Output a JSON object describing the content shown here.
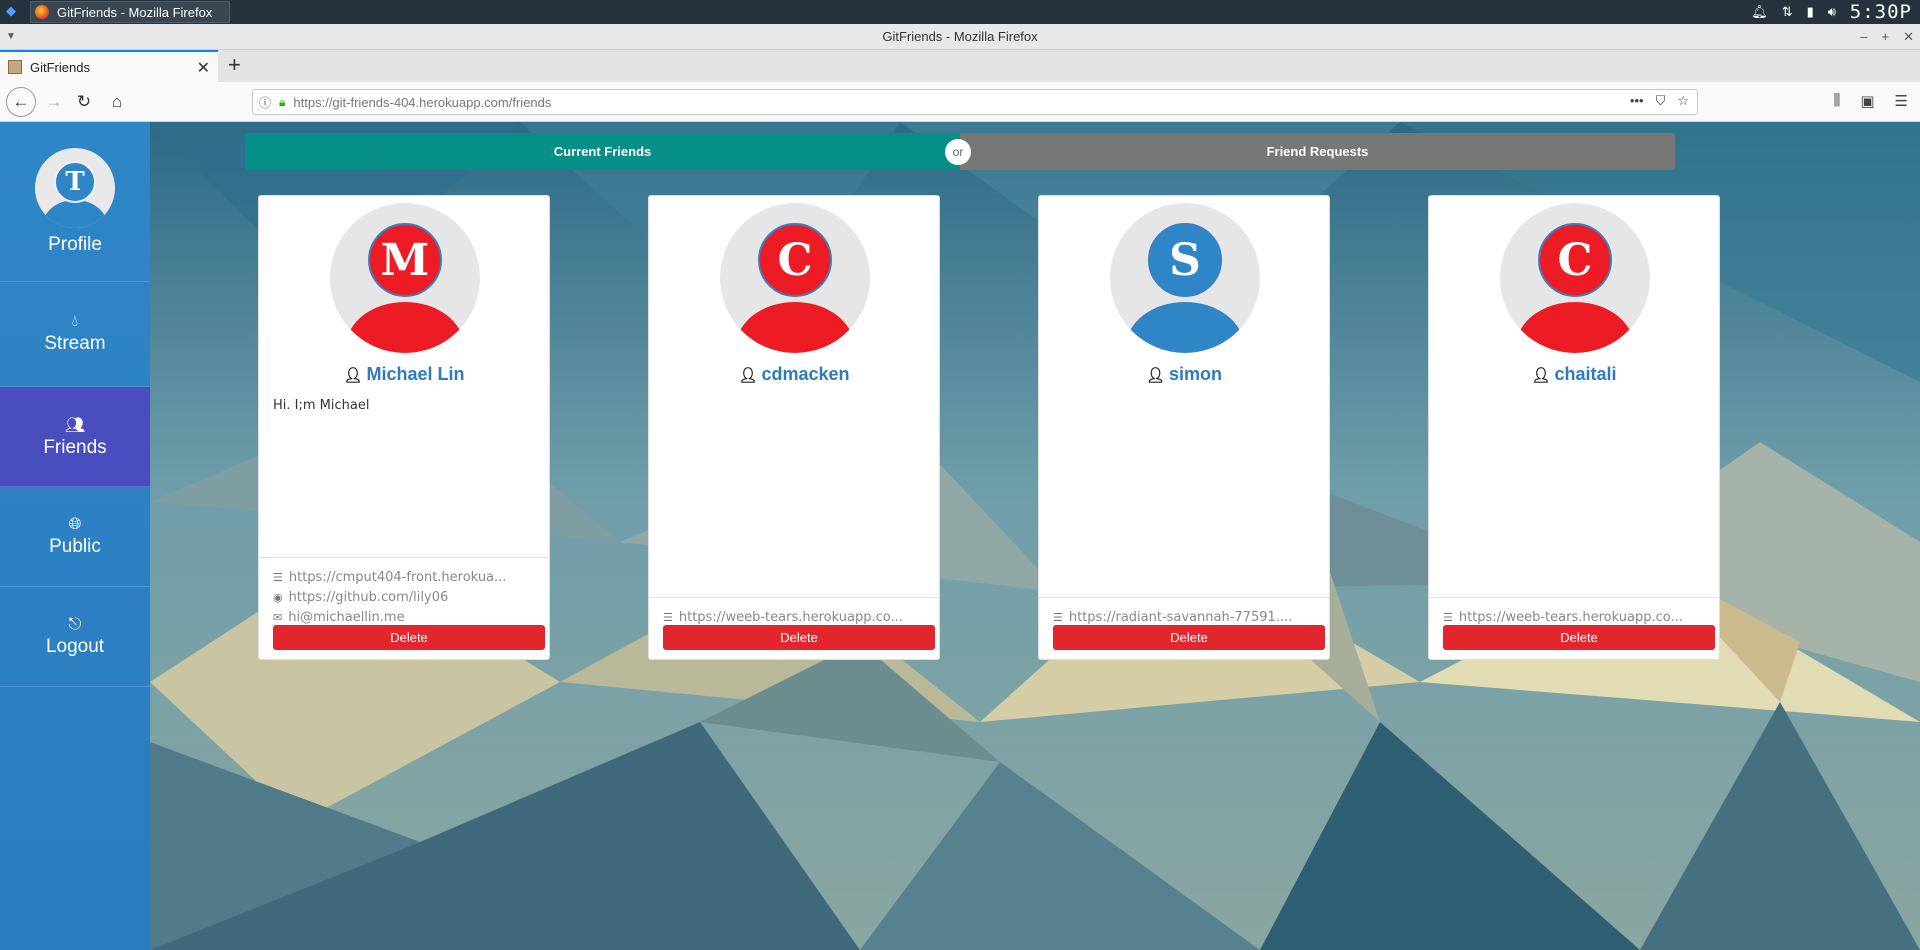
{
  "os": {
    "task_label": "GitFriends - Mozilla Firefox",
    "clock": "5:30P"
  },
  "window": {
    "title": "GitFriends - Mozilla Firefox"
  },
  "browser": {
    "tab_title": "GitFriends",
    "url_host": "https://git-friends-404.herokuapp.com",
    "url_path": "/friends"
  },
  "sidebar": {
    "avatar_letter": "T",
    "items": [
      {
        "label": "Profile",
        "icon": "user-avatar"
      },
      {
        "label": "Stream",
        "icon": "droplet-icon"
      },
      {
        "label": "Friends",
        "icon": "users-icon"
      },
      {
        "label": "Public",
        "icon": "globe-icon"
      },
      {
        "label": "Logout",
        "icon": "sign-out-icon"
      }
    ]
  },
  "toggle": {
    "current": "Current Friends",
    "or": "or",
    "requests": "Friend Requests"
  },
  "colors": {
    "red": "#ed1c24",
    "blue": "#2f86c7",
    "teal": "#068e88"
  },
  "friends": [
    {
      "letter": "M",
      "color": "#ed1c24",
      "name": "Michael Lin",
      "bio": "Hi. I;m Michael",
      "host": "https://cmput404-front.herokua...",
      "github": "https://github.com/lily06",
      "email": "hi@michaellin.me",
      "delete": "Delete"
    },
    {
      "letter": "C",
      "color": "#ed1c24",
      "name": "cdmacken",
      "host": "https://weeb-tears.herokuapp.co...",
      "delete": "Delete"
    },
    {
      "letter": "S",
      "color": "#2f86c7",
      "name": "simon",
      "host": "https://radiant-savannah-77591....",
      "delete": "Delete"
    },
    {
      "letter": "C",
      "color": "#ed1c24",
      "name": "chaitali",
      "host": "https://weeb-tears.herokuapp.co...",
      "delete": "Delete"
    }
  ]
}
